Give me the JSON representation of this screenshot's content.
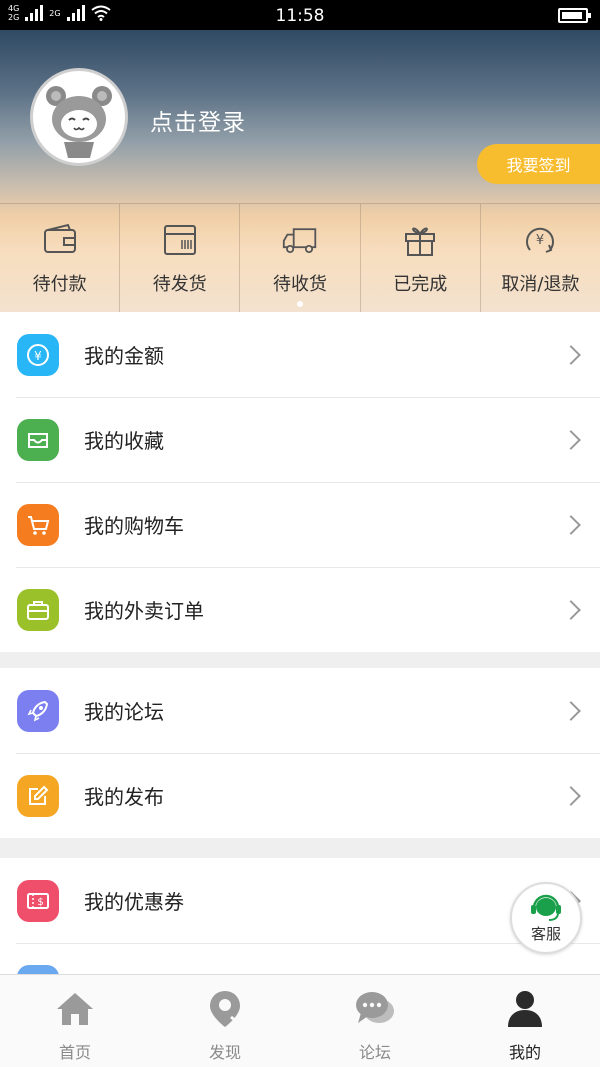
{
  "status_bar": {
    "time": "11:58",
    "network_top": "4G",
    "network_bottom": "2G",
    "network_2": "2G"
  },
  "profile": {
    "login_text": "点击登录",
    "signin_label": "我要签到"
  },
  "orders": [
    {
      "label": "待付款",
      "icon": "wallet-icon"
    },
    {
      "label": "待发货",
      "icon": "package-icon"
    },
    {
      "label": "待收货",
      "icon": "truck-icon"
    },
    {
      "label": "已完成",
      "icon": "gift-icon"
    },
    {
      "label": "取消/退款",
      "icon": "refund-icon"
    }
  ],
  "menu_group_1": [
    {
      "label": "我的金额",
      "icon": "money-icon",
      "color": "#29b6f6"
    },
    {
      "label": "我的收藏",
      "icon": "inbox-icon",
      "color": "#4caf50"
    },
    {
      "label": "我的购物车",
      "icon": "cart-icon",
      "color": "#f57c1f"
    },
    {
      "label": "我的外卖订单",
      "icon": "briefcase-icon",
      "color": "#9bc12a"
    }
  ],
  "menu_group_2": [
    {
      "label": "我的论坛",
      "icon": "rocket-icon",
      "color": "#7b7ff0"
    },
    {
      "label": "我的发布",
      "icon": "edit-icon",
      "color": "#f5a623"
    }
  ],
  "menu_group_3": [
    {
      "label": "我的优惠券",
      "icon": "coupon-icon",
      "color": "#ef4f6a"
    }
  ],
  "kefu": {
    "label": "客服"
  },
  "tabbar": [
    {
      "label": "首页",
      "icon": "home-icon",
      "active": false
    },
    {
      "label": "发现",
      "icon": "location-icon",
      "active": false
    },
    {
      "label": "论坛",
      "icon": "chat-icon",
      "active": false
    },
    {
      "label": "我的",
      "icon": "user-icon",
      "active": true
    }
  ]
}
